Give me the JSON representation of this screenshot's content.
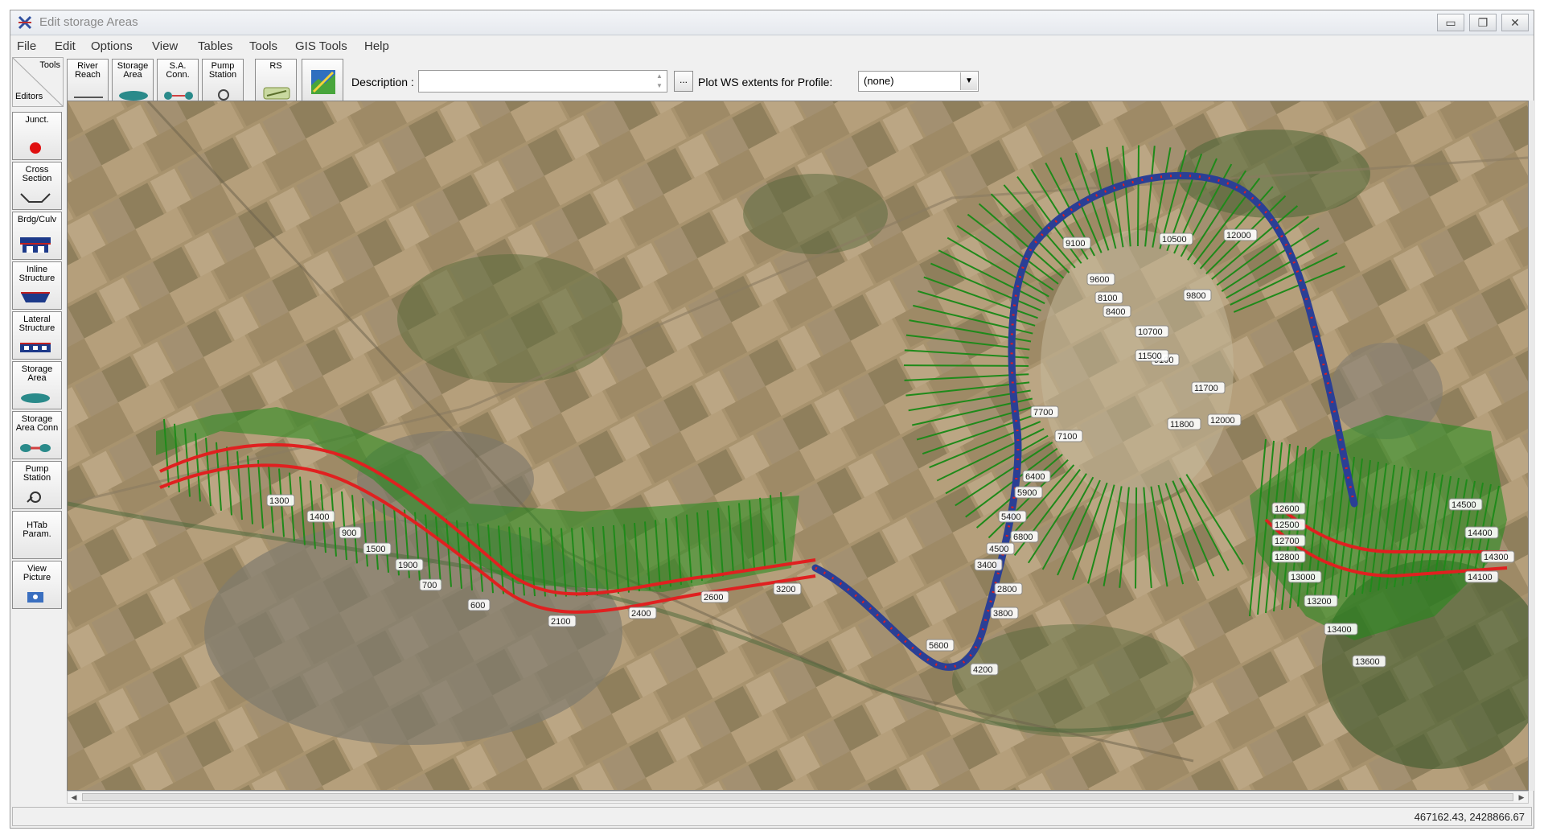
{
  "window": {
    "title": "Edit storage Areas"
  },
  "title_buttons": {
    "minimize": "▭",
    "restore": "❐",
    "close": "✕"
  },
  "menu": [
    "File",
    "Edit",
    "Options",
    "View",
    "Tables",
    "Tools",
    "GIS Tools",
    "Help"
  ],
  "tools_corner": {
    "tools": "Tools",
    "editors": "Editors"
  },
  "toolbar_buttons": [
    {
      "line1": "River",
      "line2": "Reach"
    },
    {
      "line1": "Storage",
      "line2": "Area"
    },
    {
      "line1": "S.A.",
      "line2": "Conn."
    },
    {
      "line1": "Pump",
      "line2": "Station"
    },
    {
      "line1": "RS",
      "line2": ""
    }
  ],
  "description": {
    "label": "Description :",
    "value": ""
  },
  "plot_ws": {
    "label": "Plot WS extents for Profile:",
    "value": "(none)"
  },
  "palette": [
    {
      "line1": "Junct.",
      "line2": ""
    },
    {
      "line1": "Cross",
      "line2": "Section"
    },
    {
      "line1": "Brdg/Culv",
      "line2": ""
    },
    {
      "line1": "Inline",
      "line2": "Structure"
    },
    {
      "line1": "Lateral",
      "line2": "Structure"
    },
    {
      "line1": "Storage",
      "line2": "Area"
    },
    {
      "line1": "Storage",
      "line2": "Area Conn"
    },
    {
      "line1": "Pump",
      "line2": "Station"
    },
    {
      "line1": "HTab",
      "line2": "Param."
    },
    {
      "line1": "View",
      "line2": "Picture"
    }
  ],
  "map_labels": [
    "9100",
    "10500",
    "12000",
    "9600",
    "8100",
    "9800",
    "10700",
    "8400",
    "9100",
    "11700",
    "11500",
    "11800",
    "12000",
    "7700",
    "7100",
    "6400",
    "5900",
    "5400",
    "6800",
    "4500",
    "3400",
    "2800",
    "5600",
    "4200",
    "3800",
    "12600",
    "12500",
    "12700",
    "12800",
    "13000",
    "13200",
    "13400",
    "13600",
    "14500",
    "14400",
    "14300",
    "14100",
    "1300",
    "1400",
    "900",
    "1500",
    "1900",
    "700",
    "600",
    "2100",
    "2400",
    "2600",
    "3200"
  ],
  "statusbar": {
    "coords": "467162.43, 2428866.67"
  },
  "colors": {
    "river_centerline": "#2b3f95",
    "bank_lines": "#e02020",
    "cross_sections": "#1f8a1a",
    "window_bg": "#f0f0f0"
  }
}
